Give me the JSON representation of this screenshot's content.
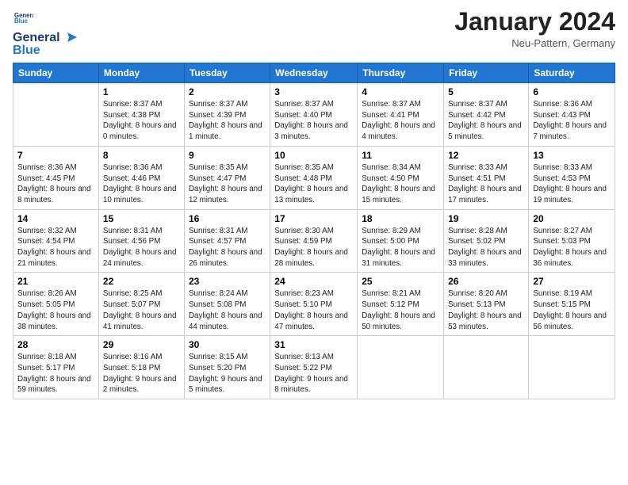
{
  "logo": {
    "line1": "General",
    "line2": "Blue"
  },
  "title": "January 2024",
  "subtitle": "Neu-Pattern, Germany",
  "days_of_week": [
    "Sunday",
    "Monday",
    "Tuesday",
    "Wednesday",
    "Thursday",
    "Friday",
    "Saturday"
  ],
  "weeks": [
    [
      {
        "day": "",
        "sunrise": "",
        "sunset": "",
        "daylight": ""
      },
      {
        "day": "1",
        "sunrise": "Sunrise: 8:37 AM",
        "sunset": "Sunset: 4:38 PM",
        "daylight": "Daylight: 8 hours and 0 minutes."
      },
      {
        "day": "2",
        "sunrise": "Sunrise: 8:37 AM",
        "sunset": "Sunset: 4:39 PM",
        "daylight": "Daylight: 8 hours and 1 minute."
      },
      {
        "day": "3",
        "sunrise": "Sunrise: 8:37 AM",
        "sunset": "Sunset: 4:40 PM",
        "daylight": "Daylight: 8 hours and 3 minutes."
      },
      {
        "day": "4",
        "sunrise": "Sunrise: 8:37 AM",
        "sunset": "Sunset: 4:41 PM",
        "daylight": "Daylight: 8 hours and 4 minutes."
      },
      {
        "day": "5",
        "sunrise": "Sunrise: 8:37 AM",
        "sunset": "Sunset: 4:42 PM",
        "daylight": "Daylight: 8 hours and 5 minutes."
      },
      {
        "day": "6",
        "sunrise": "Sunrise: 8:36 AM",
        "sunset": "Sunset: 4:43 PM",
        "daylight": "Daylight: 8 hours and 7 minutes."
      }
    ],
    [
      {
        "day": "7",
        "sunrise": "Sunrise: 8:36 AM",
        "sunset": "Sunset: 4:45 PM",
        "daylight": "Daylight: 8 hours and 8 minutes."
      },
      {
        "day": "8",
        "sunrise": "Sunrise: 8:36 AM",
        "sunset": "Sunset: 4:46 PM",
        "daylight": "Daylight: 8 hours and 10 minutes."
      },
      {
        "day": "9",
        "sunrise": "Sunrise: 8:35 AM",
        "sunset": "Sunset: 4:47 PM",
        "daylight": "Daylight: 8 hours and 12 minutes."
      },
      {
        "day": "10",
        "sunrise": "Sunrise: 8:35 AM",
        "sunset": "Sunset: 4:48 PM",
        "daylight": "Daylight: 8 hours and 13 minutes."
      },
      {
        "day": "11",
        "sunrise": "Sunrise: 8:34 AM",
        "sunset": "Sunset: 4:50 PM",
        "daylight": "Daylight: 8 hours and 15 minutes."
      },
      {
        "day": "12",
        "sunrise": "Sunrise: 8:33 AM",
        "sunset": "Sunset: 4:51 PM",
        "daylight": "Daylight: 8 hours and 17 minutes."
      },
      {
        "day": "13",
        "sunrise": "Sunrise: 8:33 AM",
        "sunset": "Sunset: 4:53 PM",
        "daylight": "Daylight: 8 hours and 19 minutes."
      }
    ],
    [
      {
        "day": "14",
        "sunrise": "Sunrise: 8:32 AM",
        "sunset": "Sunset: 4:54 PM",
        "daylight": "Daylight: 8 hours and 21 minutes."
      },
      {
        "day": "15",
        "sunrise": "Sunrise: 8:31 AM",
        "sunset": "Sunset: 4:56 PM",
        "daylight": "Daylight: 8 hours and 24 minutes."
      },
      {
        "day": "16",
        "sunrise": "Sunrise: 8:31 AM",
        "sunset": "Sunset: 4:57 PM",
        "daylight": "Daylight: 8 hours and 26 minutes."
      },
      {
        "day": "17",
        "sunrise": "Sunrise: 8:30 AM",
        "sunset": "Sunset: 4:59 PM",
        "daylight": "Daylight: 8 hours and 28 minutes."
      },
      {
        "day": "18",
        "sunrise": "Sunrise: 8:29 AM",
        "sunset": "Sunset: 5:00 PM",
        "daylight": "Daylight: 8 hours and 31 minutes."
      },
      {
        "day": "19",
        "sunrise": "Sunrise: 8:28 AM",
        "sunset": "Sunset: 5:02 PM",
        "daylight": "Daylight: 8 hours and 33 minutes."
      },
      {
        "day": "20",
        "sunrise": "Sunrise: 8:27 AM",
        "sunset": "Sunset: 5:03 PM",
        "daylight": "Daylight: 8 hours and 36 minutes."
      }
    ],
    [
      {
        "day": "21",
        "sunrise": "Sunrise: 8:26 AM",
        "sunset": "Sunset: 5:05 PM",
        "daylight": "Daylight: 8 hours and 38 minutes."
      },
      {
        "day": "22",
        "sunrise": "Sunrise: 8:25 AM",
        "sunset": "Sunset: 5:07 PM",
        "daylight": "Daylight: 8 hours and 41 minutes."
      },
      {
        "day": "23",
        "sunrise": "Sunrise: 8:24 AM",
        "sunset": "Sunset: 5:08 PM",
        "daylight": "Daylight: 8 hours and 44 minutes."
      },
      {
        "day": "24",
        "sunrise": "Sunrise: 8:23 AM",
        "sunset": "Sunset: 5:10 PM",
        "daylight": "Daylight: 8 hours and 47 minutes."
      },
      {
        "day": "25",
        "sunrise": "Sunrise: 8:21 AM",
        "sunset": "Sunset: 5:12 PM",
        "daylight": "Daylight: 8 hours and 50 minutes."
      },
      {
        "day": "26",
        "sunrise": "Sunrise: 8:20 AM",
        "sunset": "Sunset: 5:13 PM",
        "daylight": "Daylight: 8 hours and 53 minutes."
      },
      {
        "day": "27",
        "sunrise": "Sunrise: 8:19 AM",
        "sunset": "Sunset: 5:15 PM",
        "daylight": "Daylight: 8 hours and 56 minutes."
      }
    ],
    [
      {
        "day": "28",
        "sunrise": "Sunrise: 8:18 AM",
        "sunset": "Sunset: 5:17 PM",
        "daylight": "Daylight: 8 hours and 59 minutes."
      },
      {
        "day": "29",
        "sunrise": "Sunrise: 8:16 AM",
        "sunset": "Sunset: 5:18 PM",
        "daylight": "Daylight: 9 hours and 2 minutes."
      },
      {
        "day": "30",
        "sunrise": "Sunrise: 8:15 AM",
        "sunset": "Sunset: 5:20 PM",
        "daylight": "Daylight: 9 hours and 5 minutes."
      },
      {
        "day": "31",
        "sunrise": "Sunrise: 8:13 AM",
        "sunset": "Sunset: 5:22 PM",
        "daylight": "Daylight: 9 hours and 8 minutes."
      },
      {
        "day": "",
        "sunrise": "",
        "sunset": "",
        "daylight": ""
      },
      {
        "day": "",
        "sunrise": "",
        "sunset": "",
        "daylight": ""
      },
      {
        "day": "",
        "sunrise": "",
        "sunset": "",
        "daylight": ""
      }
    ]
  ]
}
